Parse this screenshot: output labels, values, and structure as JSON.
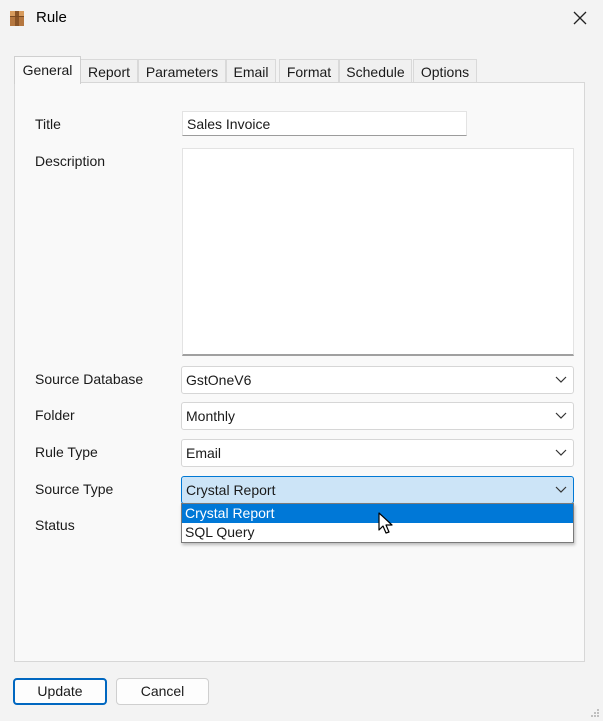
{
  "window": {
    "title": "Rule",
    "icon": "box-icon"
  },
  "tabs": [
    {
      "label": "General",
      "active": true
    },
    {
      "label": "Report"
    },
    {
      "label": "Parameters"
    },
    {
      "label": "Email"
    },
    {
      "label": "Format"
    },
    {
      "label": "Schedule"
    },
    {
      "label": "Options"
    }
  ],
  "form": {
    "title_label": "Title",
    "title_value": "Sales Invoice",
    "description_label": "Description",
    "description_value": "",
    "source_database_label": "Source Database",
    "source_database_value": "GstOneV6",
    "folder_label": "Folder",
    "folder_value": "Monthly",
    "rule_type_label": "Rule Type",
    "rule_type_value": "Email",
    "source_type_label": "Source Type",
    "source_type_value": "Crystal Report",
    "status_label": "Status"
  },
  "source_type_dropdown": {
    "options": [
      "Crystal Report",
      "SQL Query"
    ],
    "highlighted": "Crystal Report"
  },
  "buttons": {
    "update": "Update",
    "cancel": "Cancel"
  },
  "colors": {
    "accent": "#0078d7",
    "focus_fill": "#cce4f7"
  }
}
